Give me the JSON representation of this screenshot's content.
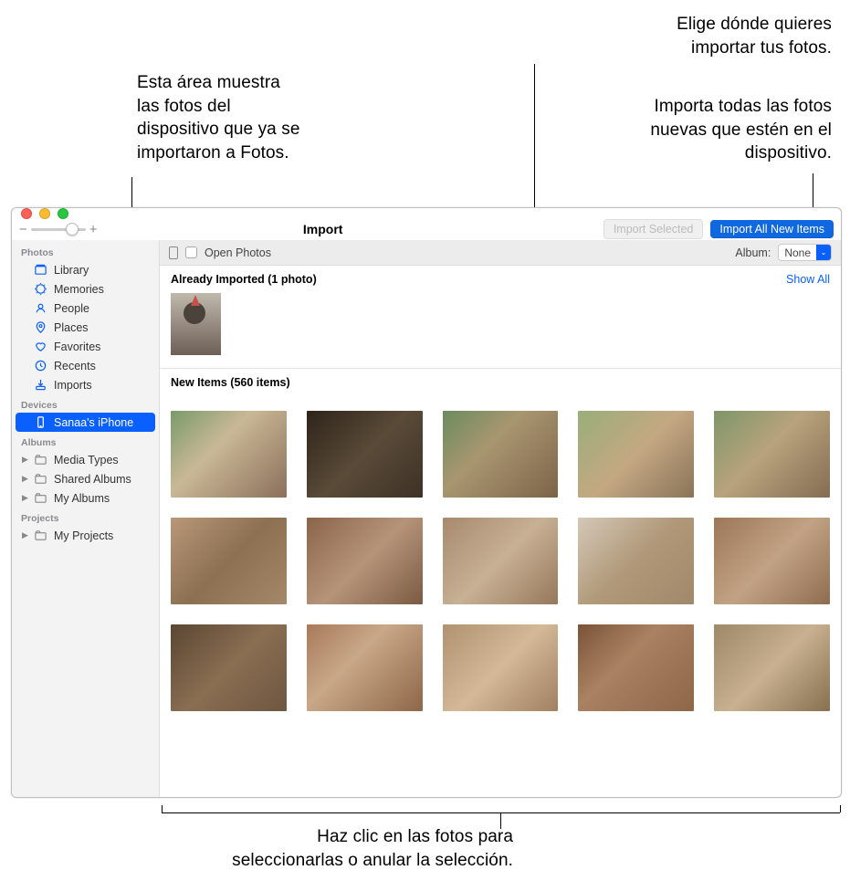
{
  "callouts": {
    "top_left": "Esta área muestra\nlas fotos del\ndispositivo que ya se\nimportaron a Fotos.",
    "top_right_1": "Elige dónde quieres\nimportar tus fotos.",
    "top_right_2": "Importa todas las fotos\nnuevas que estén en el\ndispositivo.",
    "bottom": "Haz clic en las fotos para\nseleccionarlas o anular la selección."
  },
  "toolbar": {
    "title": "Import",
    "import_selected": "Import Selected",
    "import_all": "Import All New Items"
  },
  "filterbar": {
    "open_photos": "Open Photos",
    "album_label": "Album:",
    "album_value": "None"
  },
  "sections": {
    "already_imported": "Already Imported (1 photo)",
    "show_all": "Show All",
    "new_items": "New Items (560 items)"
  },
  "sidebar": {
    "groups": [
      {
        "header": "Photos",
        "items": [
          {
            "label": "Library",
            "icon": "library"
          },
          {
            "label": "Memories",
            "icon": "memories"
          },
          {
            "label": "People",
            "icon": "people"
          },
          {
            "label": "Places",
            "icon": "places"
          },
          {
            "label": "Favorites",
            "icon": "favorites"
          },
          {
            "label": "Recents",
            "icon": "recents"
          },
          {
            "label": "Imports",
            "icon": "imports"
          }
        ]
      },
      {
        "header": "Devices",
        "items": [
          {
            "label": "Sanaa's iPhone",
            "icon": "iphone",
            "selected": true
          }
        ]
      },
      {
        "header": "Albums",
        "items": [
          {
            "label": "Media Types",
            "icon": "folder",
            "disclosure": true
          },
          {
            "label": "Shared Albums",
            "icon": "folder",
            "disclosure": true
          },
          {
            "label": "My Albums",
            "icon": "folder",
            "disclosure": true
          }
        ]
      },
      {
        "header": "Projects",
        "items": [
          {
            "label": "My Projects",
            "icon": "folder",
            "disclosure": true
          }
        ]
      }
    ]
  }
}
